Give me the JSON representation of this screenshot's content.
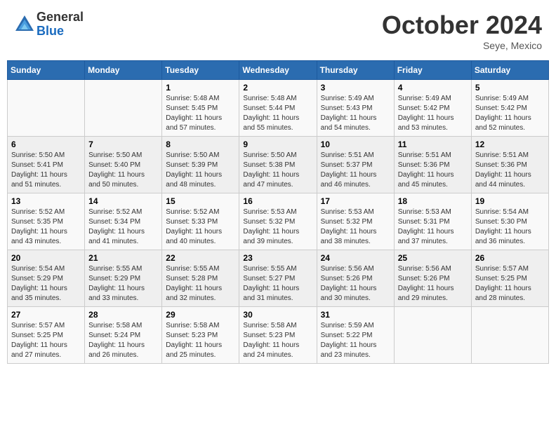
{
  "header": {
    "logo_general": "General",
    "logo_blue": "Blue",
    "month_title": "October 2024",
    "location": "Seye, Mexico"
  },
  "days_of_week": [
    "Sunday",
    "Monday",
    "Tuesday",
    "Wednesday",
    "Thursday",
    "Friday",
    "Saturday"
  ],
  "weeks": [
    [
      {
        "day": "",
        "sunrise": "",
        "sunset": "",
        "daylight": ""
      },
      {
        "day": "",
        "sunrise": "",
        "sunset": "",
        "daylight": ""
      },
      {
        "day": "1",
        "sunrise": "Sunrise: 5:48 AM",
        "sunset": "Sunset: 5:45 PM",
        "daylight": "Daylight: 11 hours and 57 minutes."
      },
      {
        "day": "2",
        "sunrise": "Sunrise: 5:48 AM",
        "sunset": "Sunset: 5:44 PM",
        "daylight": "Daylight: 11 hours and 55 minutes."
      },
      {
        "day": "3",
        "sunrise": "Sunrise: 5:49 AM",
        "sunset": "Sunset: 5:43 PM",
        "daylight": "Daylight: 11 hours and 54 minutes."
      },
      {
        "day": "4",
        "sunrise": "Sunrise: 5:49 AM",
        "sunset": "Sunset: 5:42 PM",
        "daylight": "Daylight: 11 hours and 53 minutes."
      },
      {
        "day": "5",
        "sunrise": "Sunrise: 5:49 AM",
        "sunset": "Sunset: 5:42 PM",
        "daylight": "Daylight: 11 hours and 52 minutes."
      }
    ],
    [
      {
        "day": "6",
        "sunrise": "Sunrise: 5:50 AM",
        "sunset": "Sunset: 5:41 PM",
        "daylight": "Daylight: 11 hours and 51 minutes."
      },
      {
        "day": "7",
        "sunrise": "Sunrise: 5:50 AM",
        "sunset": "Sunset: 5:40 PM",
        "daylight": "Daylight: 11 hours and 50 minutes."
      },
      {
        "day": "8",
        "sunrise": "Sunrise: 5:50 AM",
        "sunset": "Sunset: 5:39 PM",
        "daylight": "Daylight: 11 hours and 48 minutes."
      },
      {
        "day": "9",
        "sunrise": "Sunrise: 5:50 AM",
        "sunset": "Sunset: 5:38 PM",
        "daylight": "Daylight: 11 hours and 47 minutes."
      },
      {
        "day": "10",
        "sunrise": "Sunrise: 5:51 AM",
        "sunset": "Sunset: 5:37 PM",
        "daylight": "Daylight: 11 hours and 46 minutes."
      },
      {
        "day": "11",
        "sunrise": "Sunrise: 5:51 AM",
        "sunset": "Sunset: 5:36 PM",
        "daylight": "Daylight: 11 hours and 45 minutes."
      },
      {
        "day": "12",
        "sunrise": "Sunrise: 5:51 AM",
        "sunset": "Sunset: 5:36 PM",
        "daylight": "Daylight: 11 hours and 44 minutes."
      }
    ],
    [
      {
        "day": "13",
        "sunrise": "Sunrise: 5:52 AM",
        "sunset": "Sunset: 5:35 PM",
        "daylight": "Daylight: 11 hours and 43 minutes."
      },
      {
        "day": "14",
        "sunrise": "Sunrise: 5:52 AM",
        "sunset": "Sunset: 5:34 PM",
        "daylight": "Daylight: 11 hours and 41 minutes."
      },
      {
        "day": "15",
        "sunrise": "Sunrise: 5:52 AM",
        "sunset": "Sunset: 5:33 PM",
        "daylight": "Daylight: 11 hours and 40 minutes."
      },
      {
        "day": "16",
        "sunrise": "Sunrise: 5:53 AM",
        "sunset": "Sunset: 5:32 PM",
        "daylight": "Daylight: 11 hours and 39 minutes."
      },
      {
        "day": "17",
        "sunrise": "Sunrise: 5:53 AM",
        "sunset": "Sunset: 5:32 PM",
        "daylight": "Daylight: 11 hours and 38 minutes."
      },
      {
        "day": "18",
        "sunrise": "Sunrise: 5:53 AM",
        "sunset": "Sunset: 5:31 PM",
        "daylight": "Daylight: 11 hours and 37 minutes."
      },
      {
        "day": "19",
        "sunrise": "Sunrise: 5:54 AM",
        "sunset": "Sunset: 5:30 PM",
        "daylight": "Daylight: 11 hours and 36 minutes."
      }
    ],
    [
      {
        "day": "20",
        "sunrise": "Sunrise: 5:54 AM",
        "sunset": "Sunset: 5:29 PM",
        "daylight": "Daylight: 11 hours and 35 minutes."
      },
      {
        "day": "21",
        "sunrise": "Sunrise: 5:55 AM",
        "sunset": "Sunset: 5:29 PM",
        "daylight": "Daylight: 11 hours and 33 minutes."
      },
      {
        "day": "22",
        "sunrise": "Sunrise: 5:55 AM",
        "sunset": "Sunset: 5:28 PM",
        "daylight": "Daylight: 11 hours and 32 minutes."
      },
      {
        "day": "23",
        "sunrise": "Sunrise: 5:55 AM",
        "sunset": "Sunset: 5:27 PM",
        "daylight": "Daylight: 11 hours and 31 minutes."
      },
      {
        "day": "24",
        "sunrise": "Sunrise: 5:56 AM",
        "sunset": "Sunset: 5:26 PM",
        "daylight": "Daylight: 11 hours and 30 minutes."
      },
      {
        "day": "25",
        "sunrise": "Sunrise: 5:56 AM",
        "sunset": "Sunset: 5:26 PM",
        "daylight": "Daylight: 11 hours and 29 minutes."
      },
      {
        "day": "26",
        "sunrise": "Sunrise: 5:57 AM",
        "sunset": "Sunset: 5:25 PM",
        "daylight": "Daylight: 11 hours and 28 minutes."
      }
    ],
    [
      {
        "day": "27",
        "sunrise": "Sunrise: 5:57 AM",
        "sunset": "Sunset: 5:25 PM",
        "daylight": "Daylight: 11 hours and 27 minutes."
      },
      {
        "day": "28",
        "sunrise": "Sunrise: 5:58 AM",
        "sunset": "Sunset: 5:24 PM",
        "daylight": "Daylight: 11 hours and 26 minutes."
      },
      {
        "day": "29",
        "sunrise": "Sunrise: 5:58 AM",
        "sunset": "Sunset: 5:23 PM",
        "daylight": "Daylight: 11 hours and 25 minutes."
      },
      {
        "day": "30",
        "sunrise": "Sunrise: 5:58 AM",
        "sunset": "Sunset: 5:23 PM",
        "daylight": "Daylight: 11 hours and 24 minutes."
      },
      {
        "day": "31",
        "sunrise": "Sunrise: 5:59 AM",
        "sunset": "Sunset: 5:22 PM",
        "daylight": "Daylight: 11 hours and 23 minutes."
      },
      {
        "day": "",
        "sunrise": "",
        "sunset": "",
        "daylight": ""
      },
      {
        "day": "",
        "sunrise": "",
        "sunset": "",
        "daylight": ""
      }
    ]
  ]
}
